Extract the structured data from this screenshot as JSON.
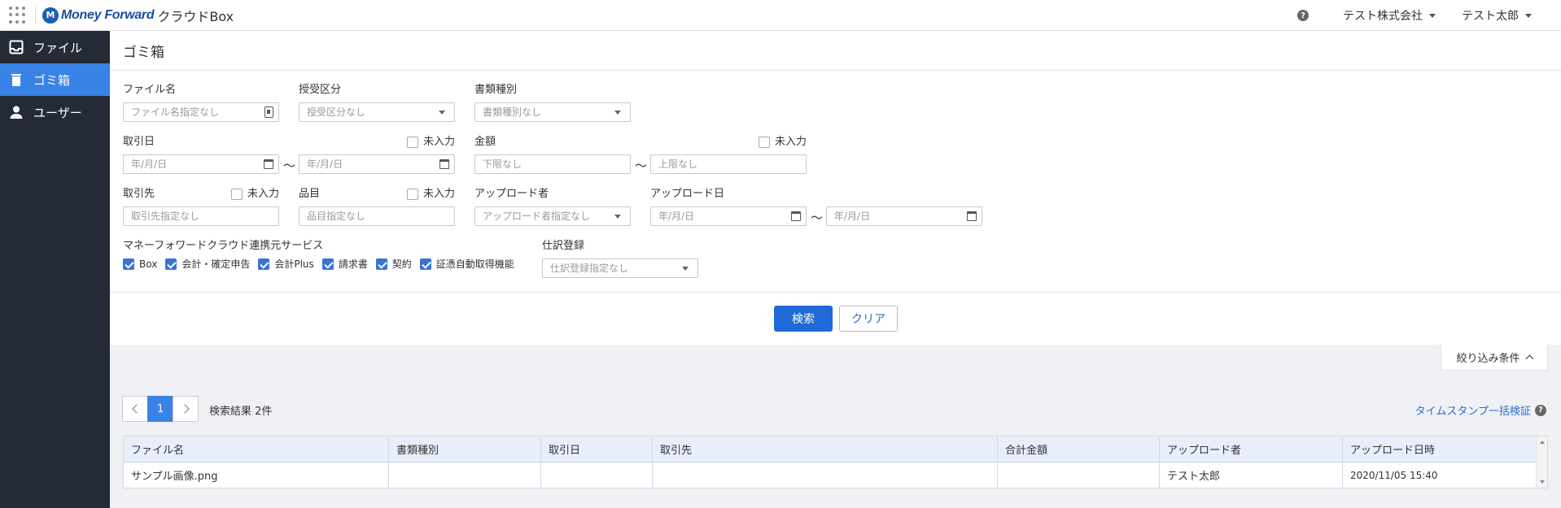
{
  "header": {
    "logo_text": "Money Forward",
    "product": "クラウドBox",
    "help": "?",
    "company": "テスト株式会社",
    "user": "テスト太郎"
  },
  "sidebar": {
    "items": [
      {
        "label": "ファイル",
        "icon": "inbox-icon"
      },
      {
        "label": "ゴミ箱",
        "icon": "trash-icon",
        "active": true
      },
      {
        "label": "ユーザー",
        "icon": "user-icon"
      }
    ]
  },
  "page": {
    "title": "ゴミ箱"
  },
  "form": {
    "file_name": {
      "label": "ファイル名",
      "placeholder": "ファイル名指定なし"
    },
    "transfer_type": {
      "label": "授受区分",
      "placeholder": "授受区分なし"
    },
    "doc_type": {
      "label": "書類種別",
      "placeholder": "書類種別なし"
    },
    "trade_date": {
      "label": "取引日",
      "from": "年/月/日",
      "to": "年/月/日",
      "empty_label": "未入力"
    },
    "amount": {
      "label": "金額",
      "min": "下限なし",
      "max": "上限なし",
      "empty_label": "未入力"
    },
    "partner": {
      "label": "取引先",
      "placeholder": "取引先指定なし",
      "empty_label": "未入力"
    },
    "item": {
      "label": "品目",
      "placeholder": "品目指定なし",
      "empty_label": "未入力"
    },
    "uploader": {
      "label": "アップロード者",
      "placeholder": "アップロード者指定なし"
    },
    "upload_date": {
      "label": "アップロード日",
      "from": "年/月/日",
      "to": "年/月/日"
    },
    "services": {
      "label": "マネーフォワードクラウド連携元サービス",
      "options": [
        "Box",
        "会計・確定申告",
        "会計Plus",
        "請求書",
        "契約",
        "証憑自動取得機能"
      ]
    },
    "journal": {
      "label": "仕訳登録",
      "placeholder": "仕訳登録指定なし"
    },
    "tilde": "〜"
  },
  "actions": {
    "search": "検索",
    "clear": "クリア"
  },
  "filter_toggle": "絞り込み条件",
  "pager": {
    "current": "1"
  },
  "result_count": "検索結果 2件",
  "timestamp_link": "タイムスタンプ一括検証",
  "table": {
    "columns": [
      "ファイル名",
      "書類種別",
      "取引日",
      "取引先",
      "合計金額",
      "アップロード者",
      "アップロード日時"
    ],
    "rows": [
      [
        "サンプル画像.png",
        "",
        "",
        "",
        "",
        "テスト太郎",
        "2020/11/05 15:40"
      ]
    ]
  },
  "colors": {
    "accent": "#3a83e6",
    "sidebar": "#252b36",
    "primary_button": "#1f6ad8"
  }
}
